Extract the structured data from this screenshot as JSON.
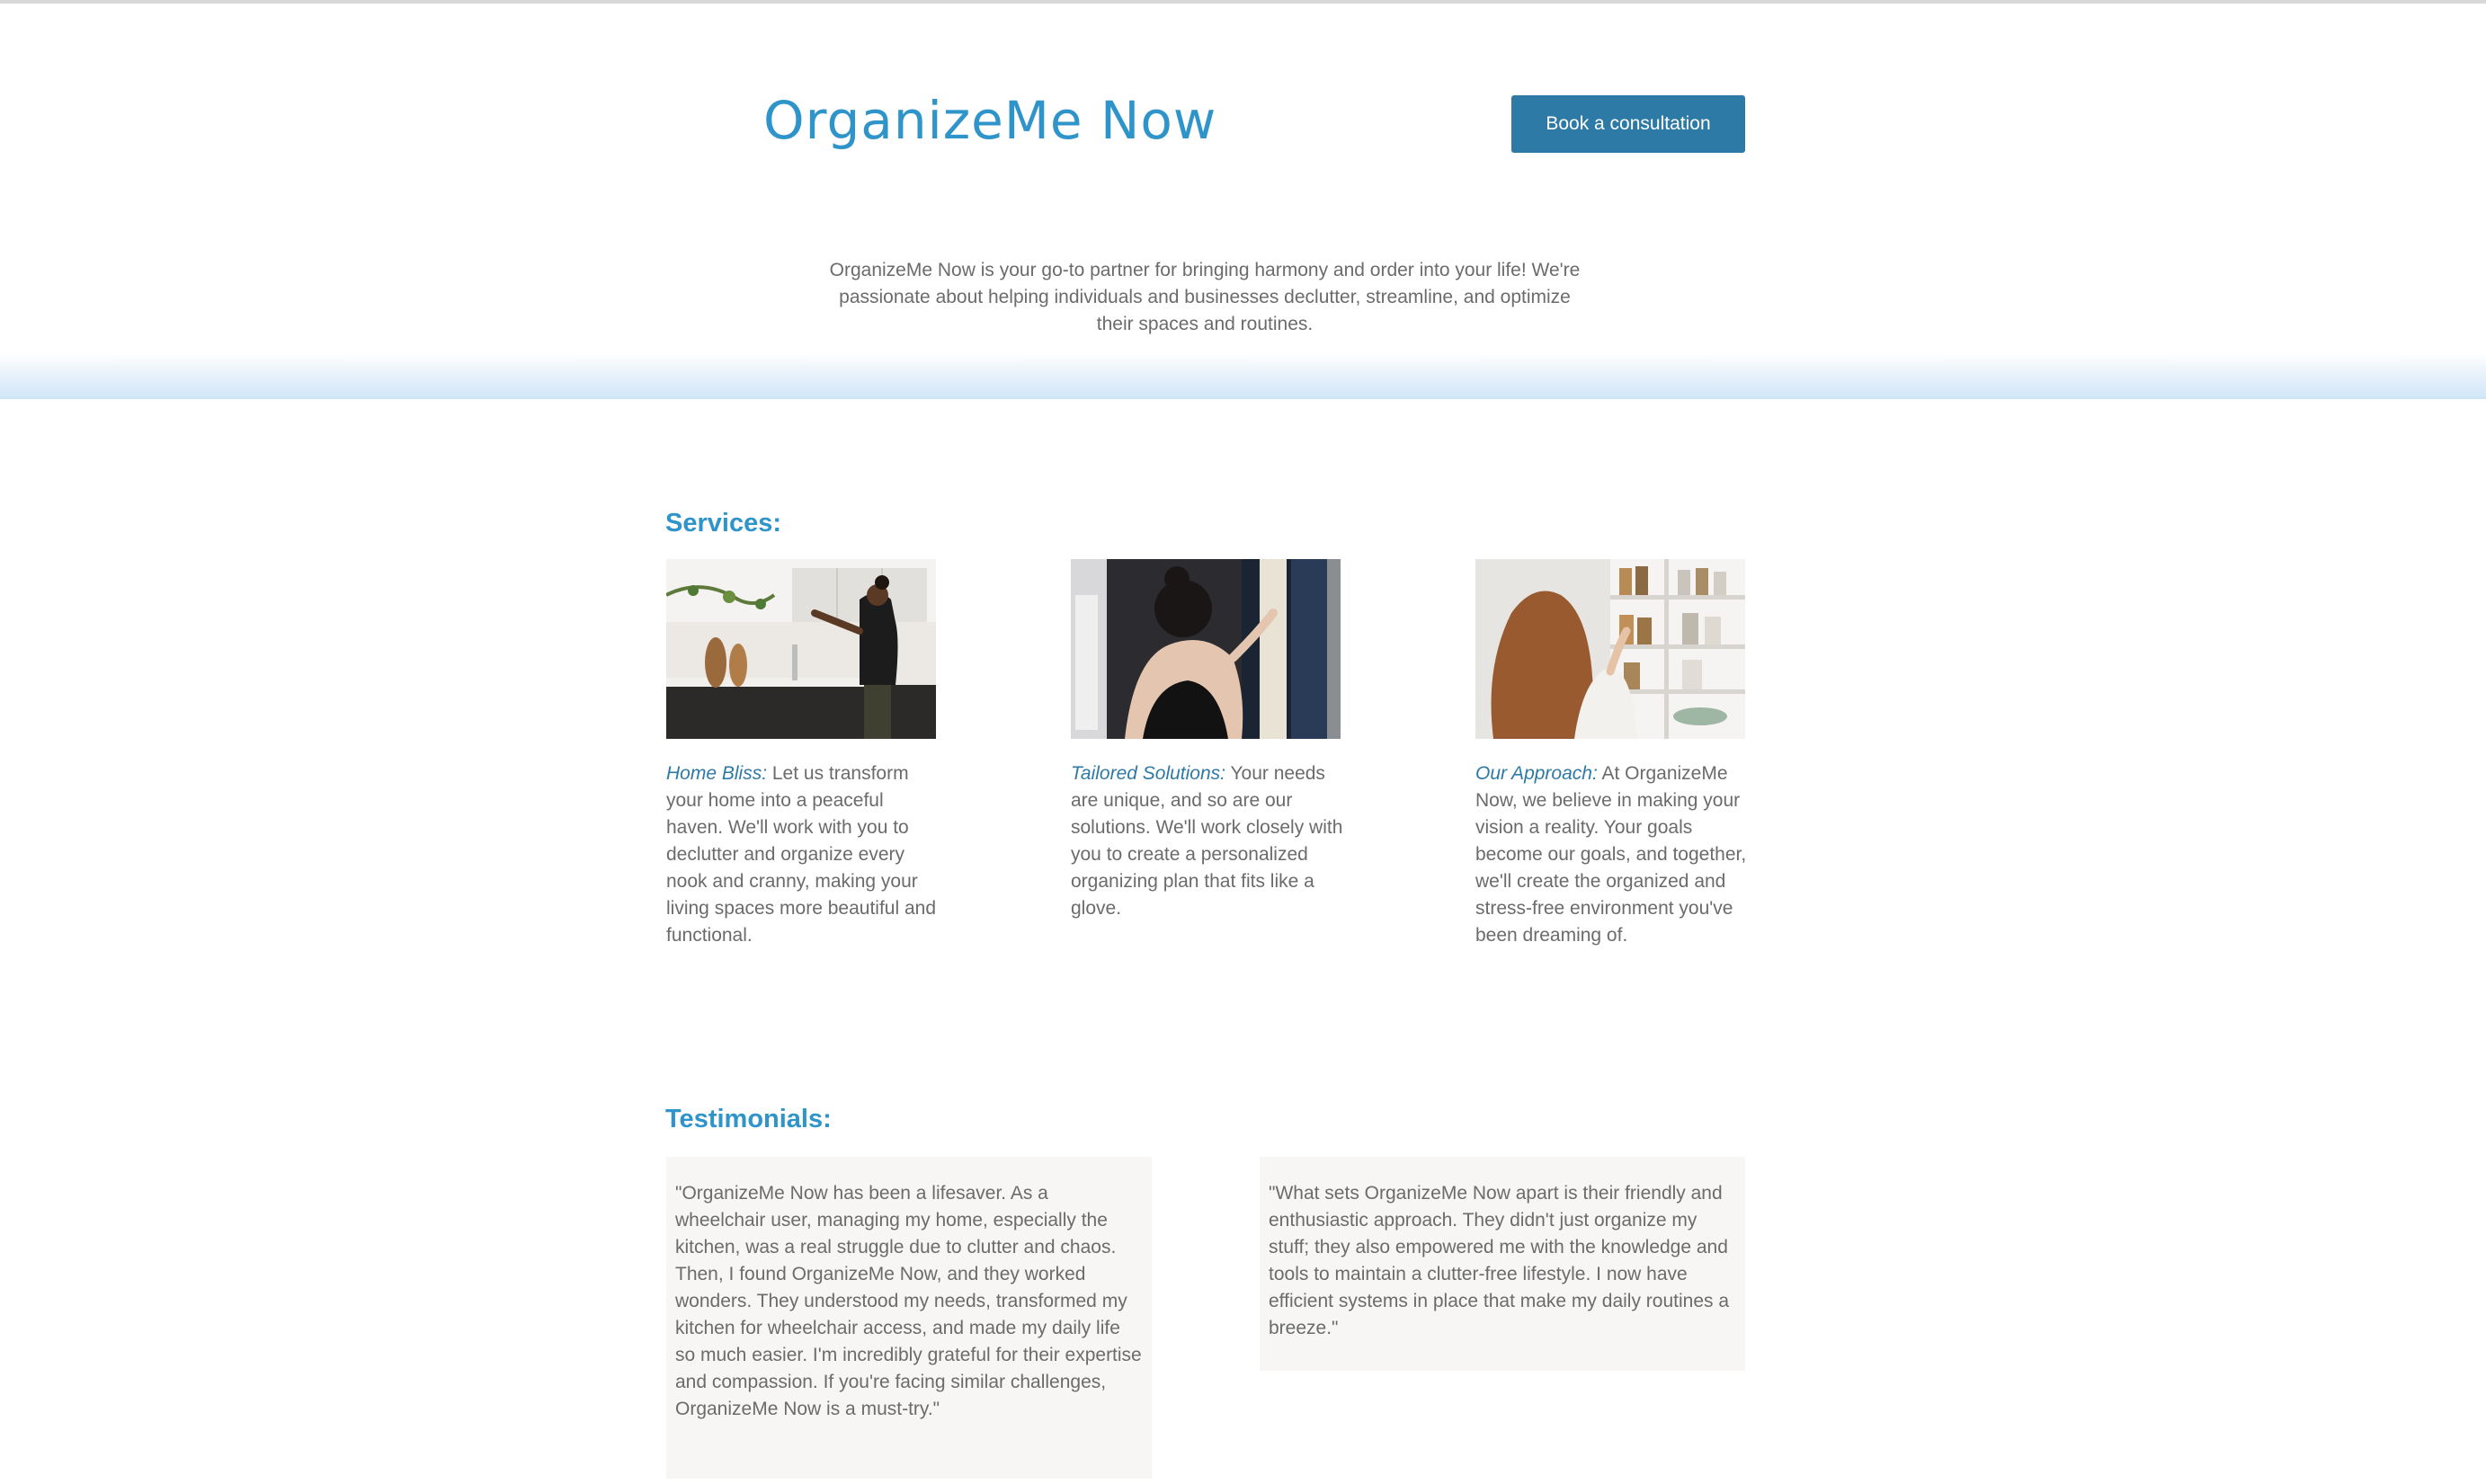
{
  "header": {
    "brand": "OrganizeMe Now",
    "cta_label": "Book a consultation",
    "intro": "OrganizeMe Now is your go-to partner for bringing harmony and order into your life! We're passionate about helping individuals and businesses declutter, streamline, and optimize their spaces and routines."
  },
  "services": {
    "title": "Services:",
    "items": [
      {
        "lead": "Home Bliss:",
        "text": " Let us transform your home into a peaceful haven. We'll work with you to declutter and organize every nook and cranny, making your living spaces more beautiful and functional."
      },
      {
        "lead": "Tailored Solutions:",
        "text": " Your needs are unique, and so are our solutions. We'll work closely with you to create a personalized organizing plan that fits like a glove."
      },
      {
        "lead": "Our Approach:",
        "text": " At OrganizeMe Now, we believe in making your vision a reality. Your goals become our goals, and together, we'll create the organized and stress-free environment you've been dreaming of."
      }
    ]
  },
  "testimonials": {
    "title": "Testimonials:",
    "items": [
      {
        "text": "\"OrganizeMe Now has been a lifesaver. As a wheelchair user, managing my home, especially the kitchen, was a real struggle due to clutter and chaos. Then, I found OrganizeMe Now, and they worked wonders. They understood my needs, transformed my kitchen for wheelchair access, and made my daily life so much easier. I'm incredibly grateful for their expertise and compassion. If you're facing similar challenges, OrganizeMe Now is a must-try.\""
      },
      {
        "text": "\"What sets OrganizeMe Now apart is their friendly and enthusiastic approach. They didn't just organize my stuff; they also empowered me with the knowledge and tools to maintain a clutter-free lifestyle. I now have efficient systems in place that make my daily routines a breeze.\""
      }
    ]
  },
  "colors": {
    "brand": "#2e94c9",
    "cta_bg": "#2e7aa6",
    "body_text": "#6b6b6b",
    "testimonial_bg": "#f7f6f5"
  }
}
